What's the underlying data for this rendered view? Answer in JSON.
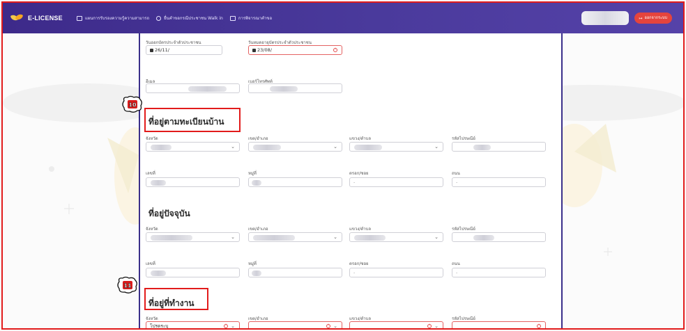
{
  "app": {
    "brand": "E-LICENSE",
    "nav": [
      {
        "label": "แผนการรับรองความรู้ความสามารถ",
        "icon": "book-icon"
      },
      {
        "label": "ยื่นคำขอกรณีประชาชน Walk in",
        "icon": "user-add-icon"
      },
      {
        "label": "การพิจารณาคำขอ",
        "icon": "document-icon"
      }
    ],
    "logout_label": "ออกจากระบบ"
  },
  "id_card": {
    "issue_label": "วันออกบัตรประจำตัวประชาชน",
    "issue_value": "26/11/",
    "expire_label": "วันหมดอายุบัตรประจำตัวประชาชน",
    "expire_value": "23/08/"
  },
  "contact": {
    "email_label": "อีเมล",
    "phone_label": "เบอร์โทรศัพท์"
  },
  "badges": {
    "house": "10",
    "work": "11"
  },
  "house_reg": {
    "title": "ที่อยู่ตามทะเบียนบ้าน",
    "province_label": "จังหวัด",
    "district_label": "เขต/อำเภอ",
    "subdistrict_label": "แขวง/ตำบล",
    "postcode_label": "รหัสไปรษณีย์",
    "house_no_label": "เลขที่",
    "moo_label": "หมู่ที่",
    "soi_label": "ตรอก/ซอย",
    "road_label": "ถนน",
    "soi_placeholder": "-",
    "road_placeholder": "-"
  },
  "current": {
    "title": "ที่อยู่ปัจจุบัน",
    "province_label": "จังหวัด",
    "district_label": "เขต/อำเภอ",
    "subdistrict_label": "แขวง/ตำบล",
    "postcode_label": "รหัสไปรษณีย์",
    "house_no_label": "เลขที่",
    "moo_label": "หมู่ที่",
    "soi_label": "ตรอก/ซอย",
    "road_label": "ถนน",
    "soi_placeholder": "-",
    "road_placeholder": "-"
  },
  "work": {
    "title": "ที่อยู่ที่ทำงาน",
    "province_label": "จังหวัด",
    "province_value": "โปรดระบุ",
    "district_label": "เขต/อำเภอ",
    "subdistrict_label": "แขวง/ตำบล",
    "postcode_label": "รหัสไปรษณีย์"
  },
  "colors": {
    "nav_bg": "#3d2a8a",
    "error": "#e24b4b",
    "logout": "#e5443d",
    "highlight": "#e21b1b"
  }
}
